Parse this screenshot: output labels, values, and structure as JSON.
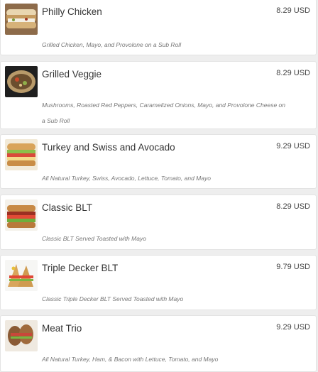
{
  "menu": {
    "items": [
      {
        "name": "Philly Chicken",
        "price": "8.29 USD",
        "description": "Grilled Chicken, Mayo, and Provolone on a Sub Roll",
        "image_icon": "philly-chicken-sandwich-photo"
      },
      {
        "name": "Grilled Veggie",
        "price": "8.29 USD",
        "description": "Mushrooms, Roasted Red Peppers, Caramelized Onions, Mayo, and Provolone Cheese on a Sub Roll",
        "image_icon": "grilled-veggie-sandwich-photo"
      },
      {
        "name": "Turkey and Swiss and Avocado",
        "price": "9.29 USD",
        "description": "All Natural Turkey, Swiss, Avocado, Lettuce, Tomato, and Mayo",
        "image_icon": "turkey-swiss-avocado-sandwich-photo"
      },
      {
        "name": "Classic BLT",
        "price": "8.29 USD",
        "description": "Classic BLT Served Toasted with Mayo",
        "image_icon": "classic-blt-sandwich-photo"
      },
      {
        "name": "Triple Decker BLT",
        "price": "9.79 USD",
        "description": "Classic Triple Decker BLT Served Toasted with Mayo",
        "image_icon": "triple-decker-blt-sandwich-photo"
      },
      {
        "name": "Meat Trio",
        "price": "9.29 USD",
        "description": "All Natural Turkey, Ham, & Bacon with Lettuce, Tomato, and Mayo",
        "image_icon": "meat-trio-sandwich-photo"
      }
    ]
  }
}
